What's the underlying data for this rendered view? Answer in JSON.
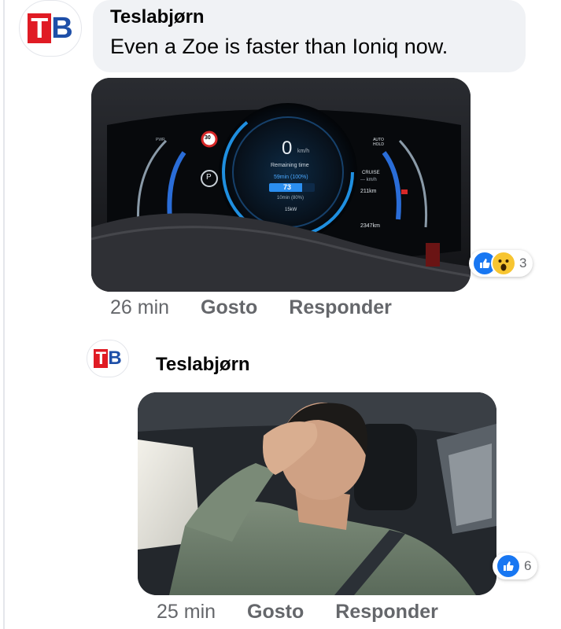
{
  "comment1": {
    "author": "Teslabjørn",
    "text": "Even a Zoe is faster than Ioniq now.",
    "time": "26 min",
    "like_label": "Gosto",
    "reply_label": "Responder",
    "reaction_count": "3",
    "reaction_icons": [
      "like-icon",
      "wow-icon"
    ]
  },
  "comment2": {
    "author": "Teslabjørn",
    "time": "25 min",
    "like_label": "Gosto",
    "reply_label": "Responder",
    "reaction_count": "6",
    "reaction_icons": [
      "like-icon"
    ]
  },
  "avatar": {
    "letters_t": "T",
    "letters_b": "B"
  },
  "dashboard": {
    "speed": "0",
    "speed_unit": "km/h",
    "remaining_label": "Remaining time",
    "time_value": "59min (100%)",
    "charge_percent": "73",
    "charge_sub": "10min (80%)",
    "power": "15kW",
    "cruise": "CRUISE",
    "cruise_speed": "--- km/h",
    "range": "211km",
    "odometer": "2347km",
    "speed_limit": "30",
    "gear": "P",
    "pwr_label": "PWR",
    "auto_hold": "AUTO HOLD"
  },
  "colors": {
    "accent_blue": "#1877f2",
    "bubble_bg": "#f0f2f5",
    "meta_gray": "#65676b",
    "wow_yellow": "#f7c531",
    "logo_red": "#e01b24",
    "logo_blue": "#1e4fa8"
  }
}
